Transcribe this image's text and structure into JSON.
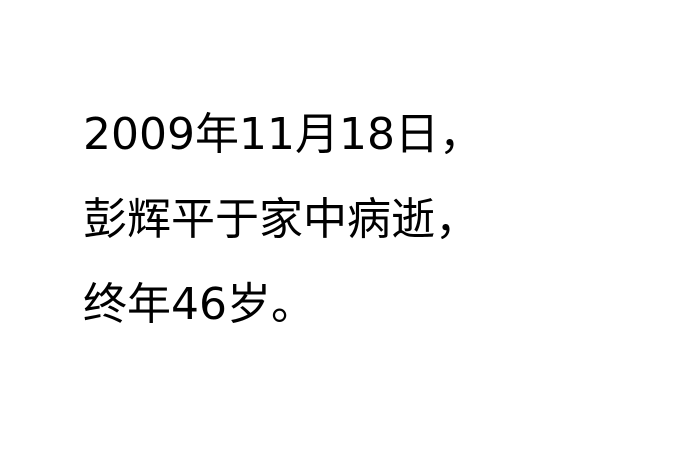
{
  "lines": [
    "2009年11月18日，",
    "彭辉平于家中病逝，",
    "终年46岁。"
  ],
  "colors": {
    "background": "#ffffff",
    "text": "#000000"
  }
}
